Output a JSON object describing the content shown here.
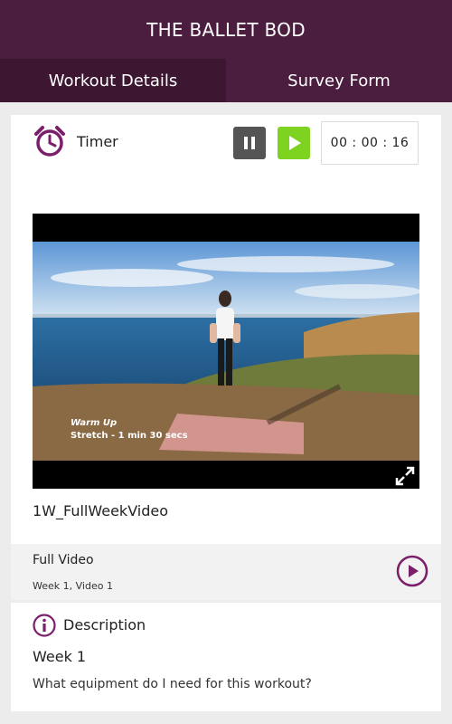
{
  "app": {
    "title": "THE BALLET BOD"
  },
  "tabs": [
    {
      "label": "Workout Details"
    },
    {
      "label": "Survey Form"
    }
  ],
  "timer": {
    "label": "Timer",
    "time": "00 : 00 : 16"
  },
  "video": {
    "overlay_line1": "Warm Up",
    "overlay_line2": "Stretch - 1 min 30 secs",
    "title": "1W_FullWeekVideo"
  },
  "sub_item": {
    "title": "Full Video",
    "meta": "Week 1, Video 1"
  },
  "description": {
    "label": "Description",
    "week": "Week 1",
    "question": "What equipment do I need for this workout?"
  },
  "colors": {
    "brand": "#4b1d3e",
    "accent": "#7b1f6a",
    "play_green": "#7ed321"
  }
}
